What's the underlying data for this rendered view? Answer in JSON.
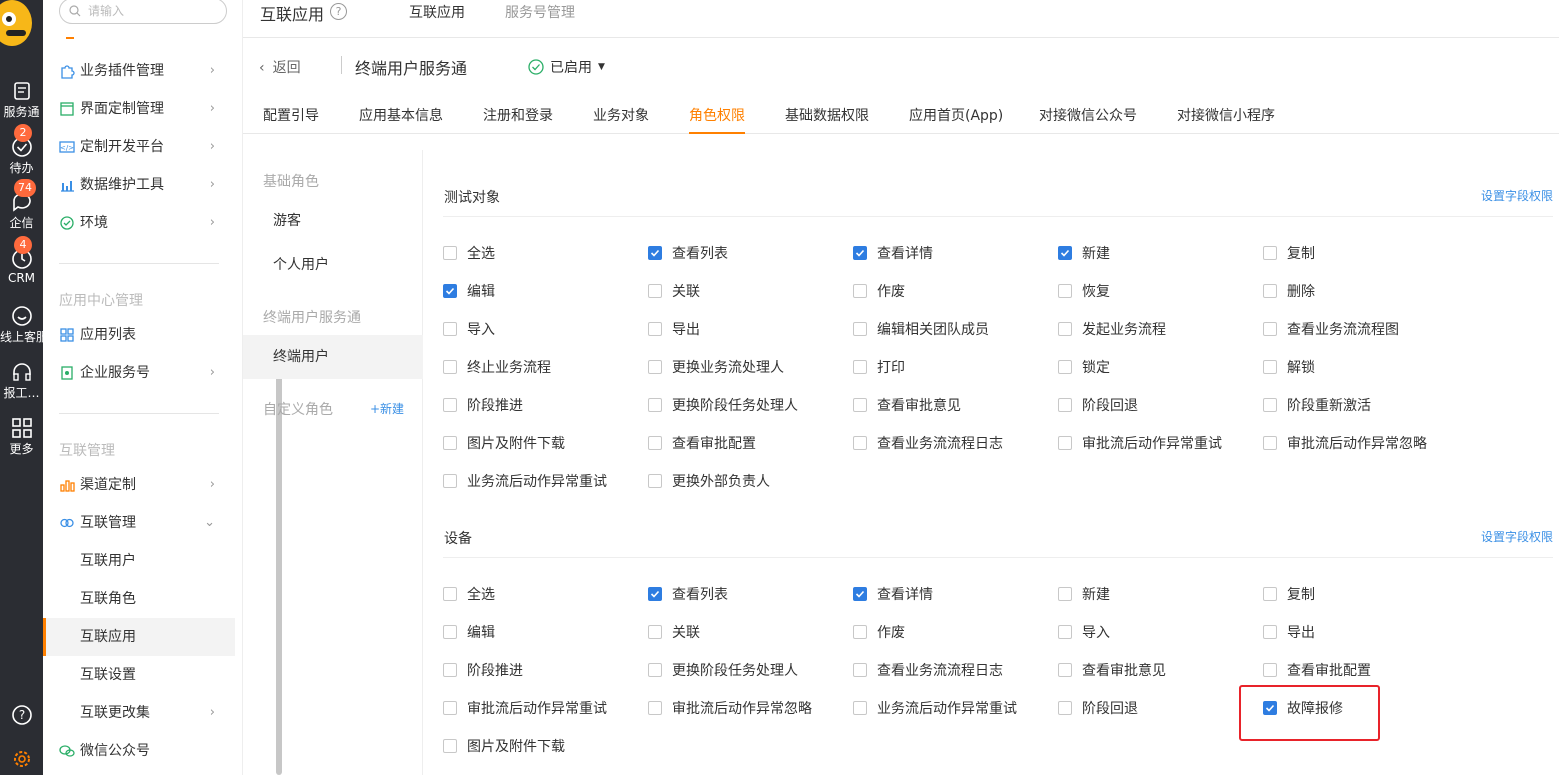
{
  "rail": {
    "items": [
      {
        "label": "服务通",
        "icon": "service-icon",
        "badge": ""
      },
      {
        "label": "待办",
        "icon": "todo-check-icon",
        "badge": "2"
      },
      {
        "label": "企信",
        "icon": "chat-bubble-icon",
        "badge": "74"
      },
      {
        "label": "CRM",
        "icon": "clock-icon",
        "badge": "4"
      },
      {
        "label": "线上客服",
        "icon": "smile-icon",
        "badge": ""
      },
      {
        "label": "报工…",
        "icon": "headset-icon",
        "badge": ""
      },
      {
        "label": "更多",
        "icon": "grid-icon",
        "badge": ""
      }
    ]
  },
  "sidebar": {
    "search_placeholder": "请输入",
    "menu_a": [
      {
        "label": "业务插件管理",
        "icon": "puzzle-icon",
        "arrow": "›"
      },
      {
        "label": "界面定制管理",
        "icon": "window-icon",
        "arrow": "›"
      },
      {
        "label": "定制开发平台",
        "icon": "code-icon",
        "arrow": "›"
      },
      {
        "label": "数据维护工具",
        "icon": "bar-chart-icon",
        "arrow": "›"
      },
      {
        "label": "环境",
        "icon": "environment-icon",
        "arrow": "›"
      }
    ],
    "section_app_center": "应用中心管理",
    "menu_b": [
      {
        "label": "应用列表",
        "icon": "app-grid-icon",
        "arrow": ""
      },
      {
        "label": "企业服务号",
        "icon": "service-account-icon",
        "arrow": "›"
      }
    ],
    "section_interconnect": "互联管理",
    "menu_c": [
      {
        "label": "渠道定制",
        "icon": "channel-icon",
        "arrow": "›"
      },
      {
        "label": "互联管理",
        "icon": "link-icon",
        "arrow": "⌄"
      }
    ],
    "sub_items": [
      {
        "label": "互联用户",
        "arrow": ""
      },
      {
        "label": "互联角色",
        "arrow": ""
      },
      {
        "label": "互联应用",
        "arrow": ""
      },
      {
        "label": "互联设置",
        "arrow": ""
      },
      {
        "label": "互联更改集",
        "arrow": "›"
      }
    ],
    "wechat": {
      "label": "微信公众号",
      "icon": "wechat-icon"
    }
  },
  "topbar": {
    "title": "互联应用",
    "help": "?",
    "tabs": [
      "互联应用",
      "服务号管理"
    ]
  },
  "header": {
    "back": "返回",
    "app_name": "终端用户服务通",
    "status": "已启用"
  },
  "tabs": [
    "配置引导",
    "应用基本信息",
    "注册和登录",
    "业务对象",
    "角色权限",
    "基础数据权限",
    "应用首页(App)",
    "对接微信公众号",
    "对接微信小程序"
  ],
  "roles": {
    "basic_title": "基础角色",
    "basic": [
      "游客",
      "个人用户"
    ],
    "app_title": "终端用户服务通",
    "app_roles": [
      "终端用户"
    ],
    "custom_title": "自定义角色",
    "new": "+新建"
  },
  "permissions": [
    {
      "title": "测试对象",
      "link": "设置字段权限",
      "items": [
        {
          "label": "全选",
          "checked": false
        },
        {
          "label": "查看列表",
          "checked": true
        },
        {
          "label": "查看详情",
          "checked": true
        },
        {
          "label": "新建",
          "checked": true
        },
        {
          "label": "复制",
          "checked": false
        },
        {
          "label": "编辑",
          "checked": true
        },
        {
          "label": "关联",
          "checked": false
        },
        {
          "label": "作废",
          "checked": false
        },
        {
          "label": "恢复",
          "checked": false
        },
        {
          "label": "删除",
          "checked": false
        },
        {
          "label": "导入",
          "checked": false
        },
        {
          "label": "导出",
          "checked": false
        },
        {
          "label": "编辑相关团队成员",
          "checked": false
        },
        {
          "label": "发起业务流程",
          "checked": false
        },
        {
          "label": "查看业务流流程图",
          "checked": false
        },
        {
          "label": "终止业务流程",
          "checked": false
        },
        {
          "label": "更换业务流处理人",
          "checked": false
        },
        {
          "label": "打印",
          "checked": false
        },
        {
          "label": "锁定",
          "checked": false
        },
        {
          "label": "解锁",
          "checked": false
        },
        {
          "label": "阶段推进",
          "checked": false
        },
        {
          "label": "更换阶段任务处理人",
          "checked": false
        },
        {
          "label": "查看审批意见",
          "checked": false
        },
        {
          "label": "阶段回退",
          "checked": false
        },
        {
          "label": "阶段重新激活",
          "checked": false
        },
        {
          "label": "图片及附件下载",
          "checked": false
        },
        {
          "label": "查看审批配置",
          "checked": false
        },
        {
          "label": "查看业务流流程日志",
          "checked": false
        },
        {
          "label": "审批流后动作异常重试",
          "checked": false
        },
        {
          "label": "审批流后动作异常忽略",
          "checked": false
        },
        {
          "label": "业务流后动作异常重试",
          "checked": false
        },
        {
          "label": "更换外部负责人",
          "checked": false
        }
      ]
    },
    {
      "title": "设备",
      "link": "设置字段权限",
      "items": [
        {
          "label": "全选",
          "checked": false
        },
        {
          "label": "查看列表",
          "checked": true
        },
        {
          "label": "查看详情",
          "checked": true
        },
        {
          "label": "新建",
          "checked": false
        },
        {
          "label": "复制",
          "checked": false
        },
        {
          "label": "编辑",
          "checked": false
        },
        {
          "label": "关联",
          "checked": false
        },
        {
          "label": "作废",
          "checked": false
        },
        {
          "label": "导入",
          "checked": false
        },
        {
          "label": "导出",
          "checked": false
        },
        {
          "label": "阶段推进",
          "checked": false
        },
        {
          "label": "更换阶段任务处理人",
          "checked": false
        },
        {
          "label": "查看业务流流程日志",
          "checked": false
        },
        {
          "label": "查看审批意见",
          "checked": false
        },
        {
          "label": "查看审批配置",
          "checked": false
        },
        {
          "label": "审批流后动作异常重试",
          "checked": false
        },
        {
          "label": "审批流后动作异常忽略",
          "checked": false
        },
        {
          "label": "业务流后动作异常重试",
          "checked": false
        },
        {
          "label": "阶段回退",
          "checked": false
        },
        {
          "label": "故障报修",
          "checked": true
        },
        {
          "label": "图片及附件下载",
          "checked": false
        }
      ]
    }
  ],
  "colors": {
    "accent": "#ff8000",
    "link": "#3a8fe5",
    "checkbox": "#2e7de1",
    "highlight": "#e8232a",
    "rail": "#2b2d33"
  }
}
